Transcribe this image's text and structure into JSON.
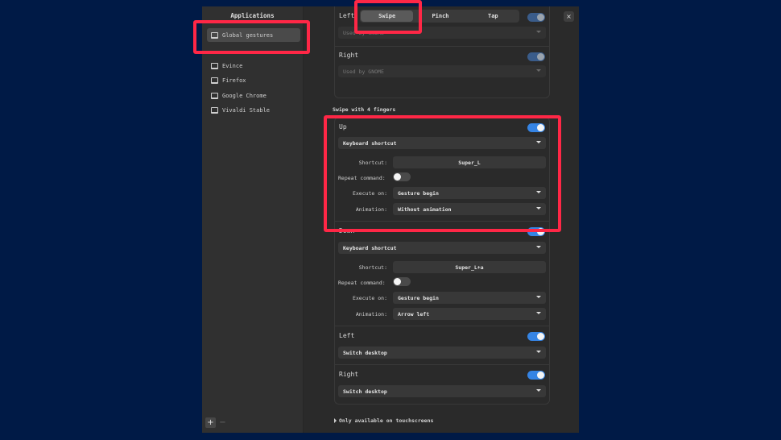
{
  "sidebar": {
    "title": "Applications",
    "items": [
      {
        "label": "Global gestures",
        "active": true
      },
      {
        "label": "Evince"
      },
      {
        "label": "Firefox"
      },
      {
        "label": "Google Chrome"
      },
      {
        "label": "Vivaldi Stable"
      }
    ],
    "add_label": "+",
    "remove_label": "−"
  },
  "tabs": [
    {
      "label": "Swipe",
      "active": true
    },
    {
      "label": "Pinch"
    },
    {
      "label": "Tap"
    }
  ],
  "close_label": "×",
  "three_finger": {
    "left": {
      "label": "Left",
      "value": "Used by GNOME"
    },
    "right": {
      "label": "Right",
      "value": "Used by GNOME"
    }
  },
  "four_finger": {
    "section_title": "Swipe with 4 fingers",
    "up": {
      "label": "Up",
      "action": "Keyboard shortcut",
      "shortcut_label": "Shortcut:",
      "shortcut": "Super_L",
      "repeat_label": "Repeat command:",
      "execute_label": "Execute on:",
      "execute": "Gesture begin",
      "animation_label": "Animation:",
      "animation": "Without animation"
    },
    "down": {
      "label": "Down",
      "action": "Keyboard shortcut",
      "shortcut_label": "Shortcut:",
      "shortcut": "Super_L+a",
      "repeat_label": "Repeat command:",
      "execute_label": "Execute on:",
      "execute": "Gesture begin",
      "animation_label": "Animation:",
      "animation": "Arrow left"
    },
    "left": {
      "label": "Left",
      "action": "Switch desktop"
    },
    "right": {
      "label": "Right",
      "action": "Switch desktop"
    }
  },
  "footer_note": "Only available on touchscreens",
  "colors": {
    "background": "#001a46",
    "highlight": "#ff2746",
    "toggle_on": "#3584e4"
  }
}
